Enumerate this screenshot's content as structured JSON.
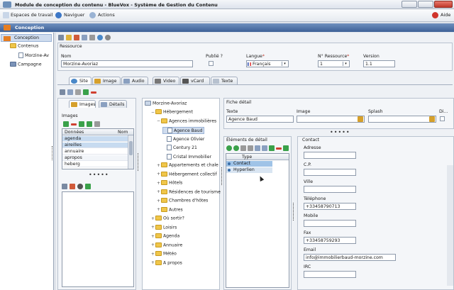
{
  "window": {
    "title": "Module de conception du contenu - BlueVox - Système de Gestion du Contenu"
  },
  "toolbar": {
    "workspaces": "Espaces de travail",
    "navigate": "Naviguer",
    "actions": "Actions",
    "help": "Aide"
  },
  "header": {
    "title": "Conception"
  },
  "nav": {
    "items": [
      {
        "label": "Conception"
      },
      {
        "label": "Contenus"
      },
      {
        "label": "Morzine-Av"
      },
      {
        "label": "Campagne"
      }
    ]
  },
  "resource": {
    "section": "Ressource",
    "name_label": "Nom",
    "name_value": "Morzine-Avoriaz",
    "public_label": "Publié ?",
    "language_label": "Langue",
    "language_value": "Français",
    "resource_no_label": "N° Ressource",
    "resource_no_value": "1",
    "version_label": "Version",
    "version_value": "1.1",
    "required_mark": "*"
  },
  "tabs": [
    {
      "label": "Site"
    },
    {
      "label": "Image"
    },
    {
      "label": "Audio"
    },
    {
      "label": "Video"
    },
    {
      "label": "vCard"
    },
    {
      "label": "Texte"
    }
  ],
  "media": {
    "tabs": [
      {
        "label": "Images"
      },
      {
        "label": "Détails"
      }
    ],
    "group": "Images",
    "col_data": "Données",
    "col_name": "Nom",
    "rows": [
      "agenda",
      "aireilles",
      "annuaire",
      "apropos",
      "heberg"
    ]
  },
  "tree": {
    "root": "Morzine-Avoriaz",
    "items": [
      "Hébergement",
      "Agences immobilières",
      "Agence Baud",
      "Agence Olivier",
      "Century 21",
      "Cristal Immobilier",
      "Appartements et chale",
      "Hébergement collectif",
      "Hôtels",
      "Résidences de tourisme",
      "Chambres d'hôtes",
      "Autres",
      "Où sortir?",
      "Loisirs",
      "Agenda",
      "Annuaire",
      "Météo",
      "A propos"
    ]
  },
  "detail": {
    "title": "Fiche détail",
    "texte_label": "Texte",
    "texte_value": "Agence Baud",
    "image_label": "Image",
    "splash_label": "Splash",
    "di_label": "Di...",
    "elements_title": "Éléments de détail",
    "type_col": "Type",
    "elements": [
      "Contact",
      "Hyperlien"
    ]
  },
  "contact": {
    "title": "Contact",
    "fields": [
      {
        "label": "Adresse",
        "value": ""
      },
      {
        "label": "C.P.",
        "value": ""
      },
      {
        "label": "Ville",
        "value": ""
      },
      {
        "label": "Téléphone",
        "value": "+33458790713"
      },
      {
        "label": "Mobile",
        "value": ""
      },
      {
        "label": "Fax",
        "value": "+33458759293"
      },
      {
        "label": "Email",
        "value": "info@immobilierbaud-morzine.com"
      },
      {
        "label": "IRC",
        "value": ""
      }
    ]
  },
  "colors": {
    "header": "#3d6197",
    "selected": "#cfdcee",
    "folder": "#f0c64a"
  }
}
